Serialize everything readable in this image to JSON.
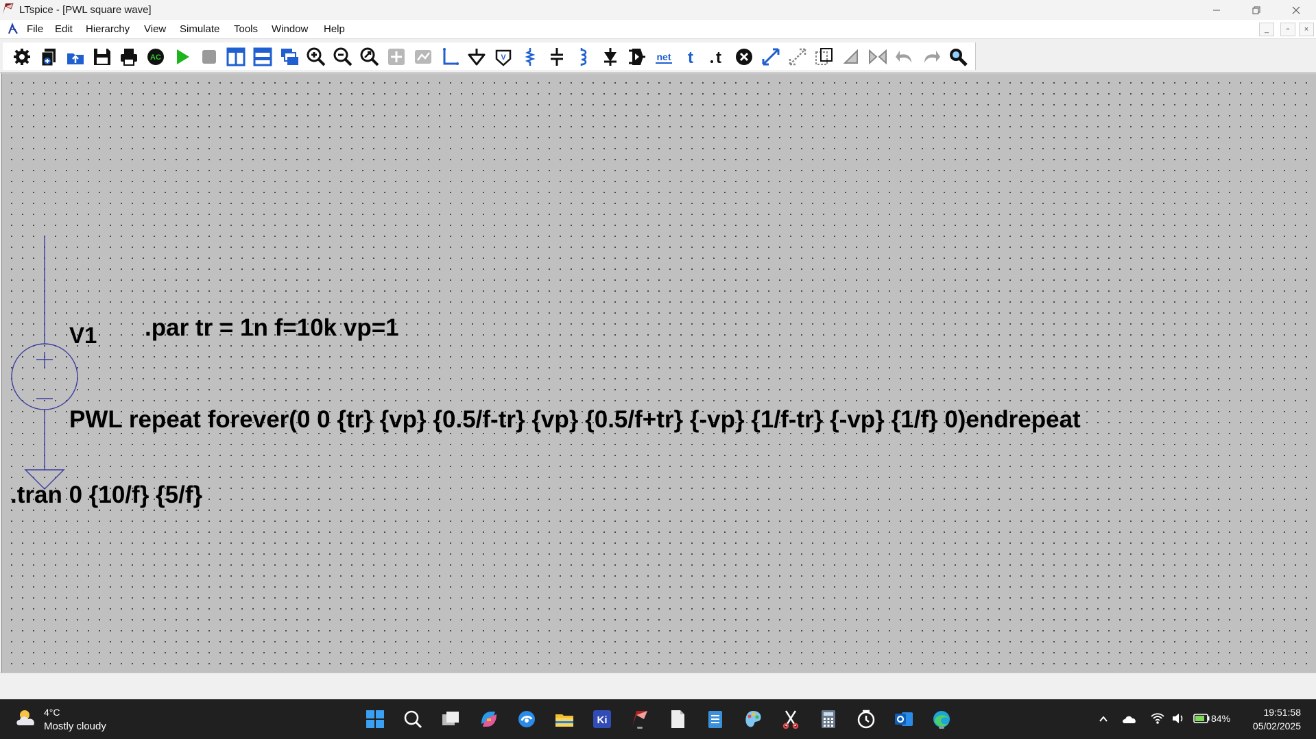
{
  "window": {
    "title": "LTspice - [PWL square wave]"
  },
  "menubar": {
    "items": [
      "File",
      "Edit",
      "Hierarchy",
      "View",
      "Simulate",
      "Tools",
      "Window",
      "Help"
    ],
    "mdi_buttons": [
      "_",
      "▫",
      "×"
    ]
  },
  "toolbar": {
    "icons": [
      "settings-icon",
      "new-schematic-icon",
      "open-icon",
      "save-icon",
      "print-icon",
      "ac-control-icon",
      "run-icon",
      "halt-icon",
      "tile-vertical-icon",
      "tile-horizontal-icon",
      "cascade-icon",
      "zoom-in-icon",
      "zoom-out-icon",
      "zoom-fit-icon",
      "zoom-pan-icon",
      "autorange-icon",
      "wire-icon",
      "ground-icon",
      "label-net-icon",
      "resistor-icon",
      "capacitor-icon",
      "inductor-icon",
      "diode-icon",
      "component-icon",
      "spice-netlist-icon",
      "text-icon",
      "spice-directive-icon",
      "delete-icon",
      "move-icon",
      "drag-icon",
      "duplicate-icon",
      "rotate-icon",
      "mirror-icon",
      "undo-icon",
      "redo-icon",
      "find-icon"
    ],
    "net_label": "net"
  },
  "schematic": {
    "component_name": "V1",
    "par_directive": ".par tr = 1n f=10k vp=1",
    "pwl_value": "PWL repeat forever(0 0 {tr} {vp} {0.5/f-tr} {vp} {0.5/f+tr} {-vp} {1/f-tr} {-vp} {1/f} 0)endrepeat",
    "tran_directive": ".tran 0 {10/f} {5/f}",
    "colors": {
      "background": "#c0c0c0",
      "wire": "#3c3ca0",
      "text": "#000000"
    }
  },
  "taskbar": {
    "weather_temp": "4°C",
    "weather_desc": "Mostly cloudy",
    "apps": [
      "start-icon",
      "search-icon",
      "task-view-icon",
      "copilot-icon",
      "edge-browser-icon",
      "file-explorer-icon",
      "kicad-icon",
      "ltspice-icon",
      "file-icon",
      "notepad-icon",
      "paint-icon",
      "snipping-tool-icon",
      "calculator-icon",
      "clock-icon",
      "outlook-icon",
      "edge-icon"
    ],
    "battery_percent": "84%",
    "time": "19:51:58",
    "date": "05/02/2025"
  }
}
